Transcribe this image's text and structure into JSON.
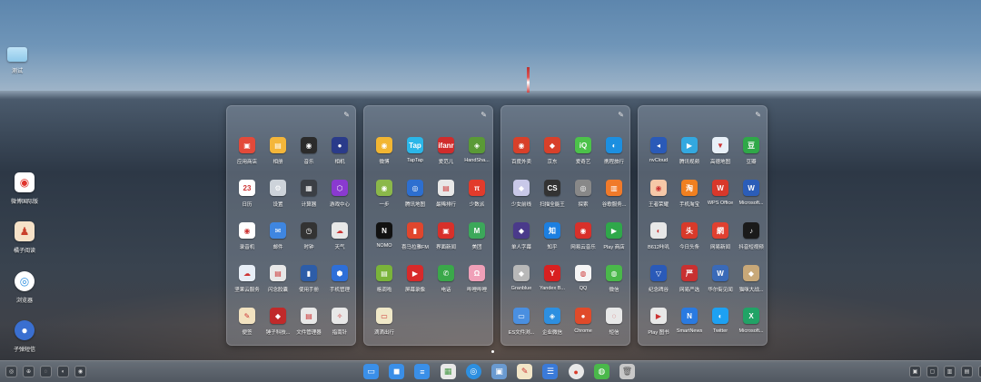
{
  "desktop": {
    "folder_label": "测试",
    "shortcuts": [
      {
        "label": "微博国际版",
        "icon": "weibo-intl-icon"
      },
      {
        "label": "橘子阅读",
        "icon": "orange-reader-icon"
      },
      {
        "label": "浏览器",
        "icon": "browser-icon"
      },
      {
        "label": "子弹短信",
        "icon": "bullet-message-icon"
      }
    ]
  },
  "edit_glyph": "✎",
  "panels": [
    {
      "apps": [
        [
          "应用商店",
          "相册",
          "音乐",
          "相机"
        ],
        [
          "日历",
          "设置",
          "计算器",
          "游戏中心"
        ],
        [
          "录音机",
          "邮件",
          "时钟",
          "天气"
        ],
        [
          "坚果云服务",
          "闪念胶囊",
          "使用手册",
          "手机管理"
        ],
        [
          "便签",
          "锤子科技...",
          "文件管理器",
          "指南针"
        ]
      ]
    },
    {
      "apps": [
        [
          "微博",
          "TapTap",
          "爱范儿",
          "HandSha..."
        ],
        [
          "一步",
          "腾讯地图",
          "最稀排行",
          "少数派"
        ],
        [
          "NOMO",
          "喜马拉雅FM",
          "界面新闻",
          "美团"
        ],
        [
          "格调啦",
          "屏幕录像",
          "电话",
          "哔哩哔哩"
        ],
        [
          "滴滴出行"
        ]
      ]
    },
    {
      "apps": [
        [
          "百度外卖",
          "京东",
          "爱奇艺",
          "携程旅行"
        ],
        [
          "少女前线",
          "扫描全能王",
          "探索",
          "谷歌服务..."
        ],
        [
          "单人字幕",
          "知乎",
          "网易云音乐",
          "Play 商店"
        ],
        [
          "Granblue",
          "Yandex B...",
          "QQ",
          "微信"
        ],
        [
          "ES文件浏...",
          "企业微信",
          "Chrome",
          "短信"
        ]
      ]
    },
    {
      "apps": [
        [
          "nvCloud",
          "腾讯视频",
          "高德地图",
          "豆瓣"
        ],
        [
          "王者荣耀",
          "手机淘宝",
          "WPS Office",
          "Microsoft..."
        ],
        [
          "B612咔叽",
          "今日头条",
          "网易新闻",
          "抖音短视频"
        ],
        [
          "纪念碑谷",
          "网易严选",
          "华尔街见闻",
          "猫咪大战..."
        ],
        [
          "Play 图书",
          "SmartNews",
          "Twitter",
          "Microsoft..."
        ]
      ]
    }
  ],
  "dock": {
    "left_tray": [
      "◎",
      "⊕",
      "◌",
      "◐",
      "◉"
    ],
    "apps": [
      {
        "icon": "chat-icon",
        "glyph": "▭"
      },
      {
        "icon": "video-icon",
        "glyph": "◼"
      },
      {
        "icon": "notes-icon",
        "glyph": "≡"
      },
      {
        "icon": "gallery-icon",
        "glyph": "▦"
      },
      {
        "icon": "browser-icon",
        "glyph": "◎"
      },
      {
        "icon": "map-icon",
        "glyph": "▣"
      },
      {
        "icon": "notepad-icon",
        "glyph": "✎"
      },
      {
        "icon": "message-icon",
        "glyph": "☰"
      },
      {
        "icon": "chrome-icon",
        "glyph": "●"
      },
      {
        "icon": "wechat-icon",
        "glyph": "◍"
      },
      {
        "icon": "trash-icon",
        "glyph": "🗑"
      }
    ],
    "right_tray": [
      "▣",
      "▢",
      "▥",
      "▤",
      "▦"
    ]
  }
}
